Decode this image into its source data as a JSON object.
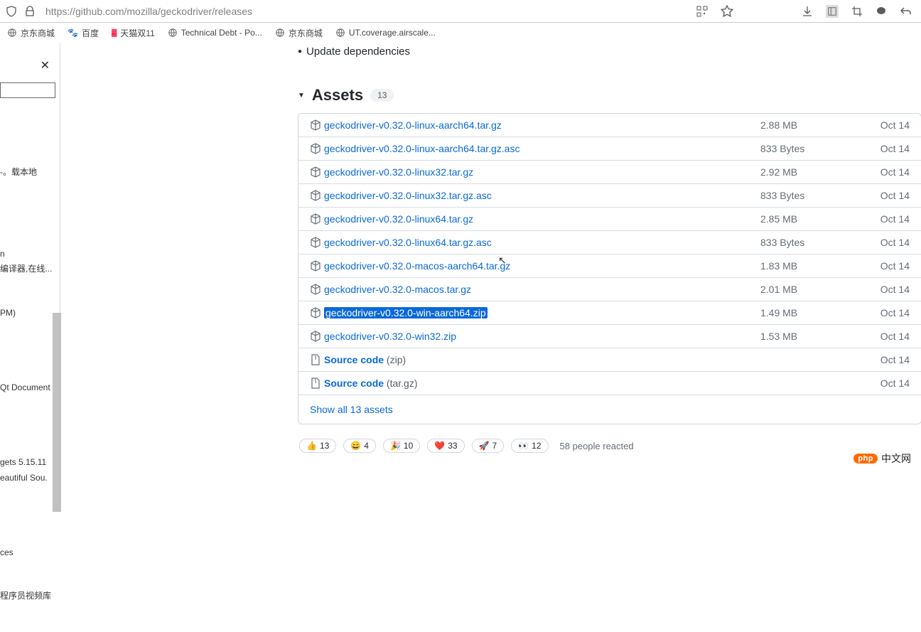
{
  "browser": {
    "url": "https://github.com/mozilla/geckodriver/releases"
  },
  "bookmarks": [
    {
      "label": "京东商城"
    },
    {
      "label": "百度"
    },
    {
      "label": "天猫双11"
    },
    {
      "label": "Technical Debt - Po..."
    },
    {
      "label": "京东商城"
    },
    {
      "label": "UT.coverage.airscale..."
    }
  ],
  "sidebar": {
    "items": [
      "载本地。-",
      "n\n编译器,在线...",
      "PM)",
      "Qt Document",
      "gets 5.15.11\neautiful Sou.",
      "ces",
      "程序员视频库"
    ]
  },
  "release": {
    "update_line": "Update dependencies",
    "assets_title": "Assets",
    "assets_count": "13",
    "assets": [
      {
        "name": "geckodriver-v0.32.0-linux-aarch64.tar.gz",
        "size": "2.88 MB",
        "date": "Oct 14",
        "type": "pkg"
      },
      {
        "name": "geckodriver-v0.32.0-linux-aarch64.tar.gz.asc",
        "size": "833 Bytes",
        "date": "Oct 14",
        "type": "pkg"
      },
      {
        "name": "geckodriver-v0.32.0-linux32.tar.gz",
        "size": "2.92 MB",
        "date": "Oct 14",
        "type": "pkg"
      },
      {
        "name": "geckodriver-v0.32.0-linux32.tar.gz.asc",
        "size": "833 Bytes",
        "date": "Oct 14",
        "type": "pkg"
      },
      {
        "name": "geckodriver-v0.32.0-linux64.tar.gz",
        "size": "2.85 MB",
        "date": "Oct 14",
        "type": "pkg"
      },
      {
        "name": "geckodriver-v0.32.0-linux64.tar.gz.asc",
        "size": "833 Bytes",
        "date": "Oct 14",
        "type": "pkg"
      },
      {
        "name": "geckodriver-v0.32.0-macos-aarch64.tar.gz",
        "size": "1.83 MB",
        "date": "Oct 14",
        "type": "pkg"
      },
      {
        "name": "geckodriver-v0.32.0-macos.tar.gz",
        "size": "2.01 MB",
        "date": "Oct 14",
        "type": "pkg"
      },
      {
        "name": "geckodriver-v0.32.0-win-aarch64.zip",
        "size": "1.49 MB",
        "date": "Oct 14",
        "type": "pkg",
        "highlighted": true
      },
      {
        "name": "geckodriver-v0.32.0-win32.zip",
        "size": "1.53 MB",
        "date": "Oct 14",
        "type": "pkg"
      },
      {
        "name": "Source code",
        "ext": "(zip)",
        "size": "",
        "date": "Oct 14",
        "type": "src"
      },
      {
        "name": "Source code",
        "ext": "(tar.gz)",
        "size": "",
        "date": "Oct 14",
        "type": "src"
      }
    ],
    "show_all": "Show all 13 assets",
    "reactions": [
      {
        "emoji": "👍",
        "count": "13"
      },
      {
        "emoji": "😄",
        "count": "4"
      },
      {
        "emoji": "🎉",
        "count": "10"
      },
      {
        "emoji": "❤️",
        "count": "33"
      },
      {
        "emoji": "🚀",
        "count": "7"
      },
      {
        "emoji": "👀",
        "count": "12"
      }
    ],
    "reacted_text": "58 people reacted"
  },
  "watermark": {
    "pill": "php",
    "text": "中文网"
  }
}
